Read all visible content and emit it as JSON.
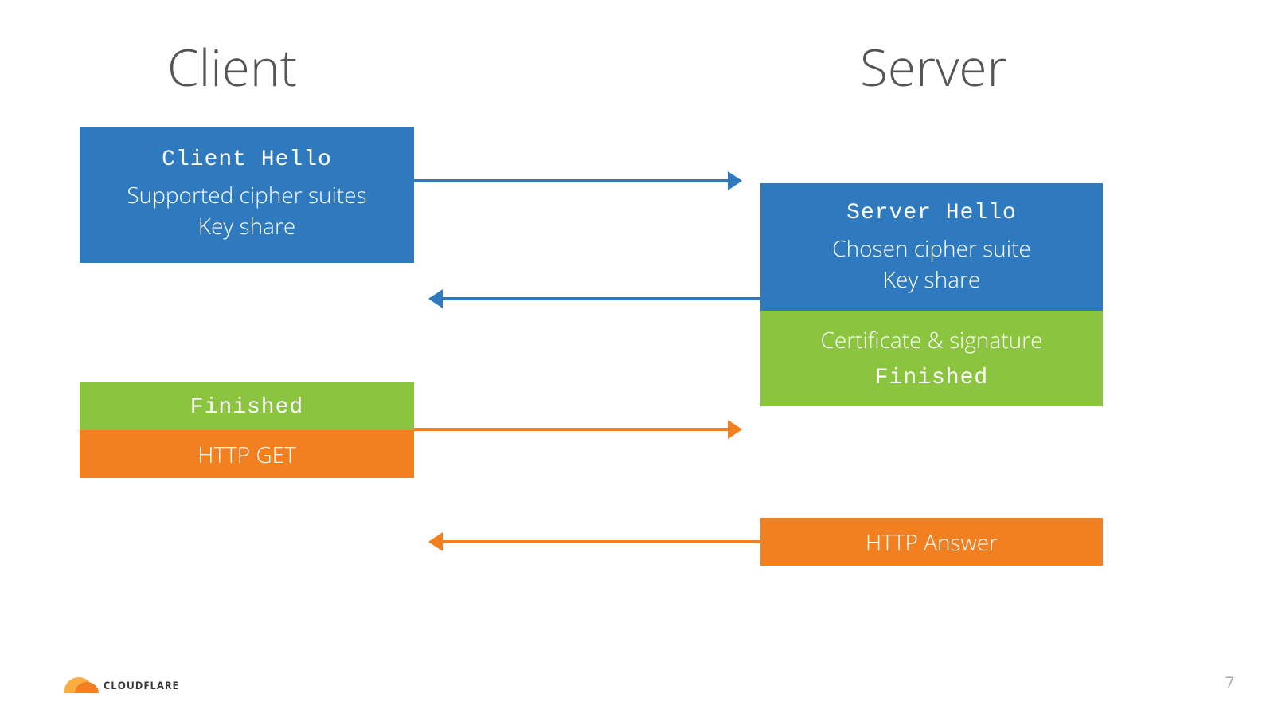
{
  "headings": {
    "client": "Client",
    "server": "Server"
  },
  "client_hello": {
    "title": "Client Hello",
    "line1": "Supported cipher suites",
    "line2": "Key share"
  },
  "server_hello": {
    "title": "Server Hello",
    "line1": "Chosen cipher suite",
    "line2": "Key share"
  },
  "server_cert": {
    "line1": "Certificate & signature",
    "line2": "Finished"
  },
  "client_finished": "Finished",
  "client_http": "HTTP GET",
  "server_http": "HTTP Answer",
  "logo": "CLOUDFLARE",
  "page_number": "7",
  "colors": {
    "blue": "#2f7abf",
    "green": "#8bc53f",
    "orange": "#f38020"
  }
}
